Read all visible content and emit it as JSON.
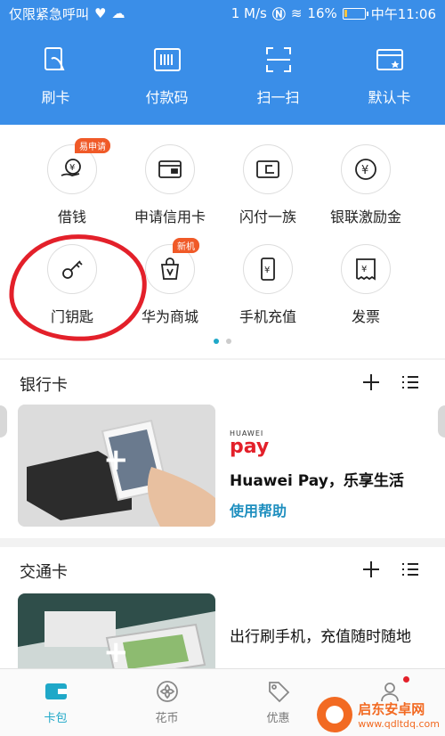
{
  "status": {
    "carrier": "仅限紧急呼叫",
    "speed": "1 M/s",
    "battery": "16%",
    "time": "中午11:06",
    "battery_level": 0.16
  },
  "quick": [
    {
      "label": "刷卡",
      "icon": "nfc-card-icon"
    },
    {
      "label": "付款码",
      "icon": "barcode-icon"
    },
    {
      "label": "扫一扫",
      "icon": "scan-icon"
    },
    {
      "label": "默认卡",
      "icon": "default-card-icon"
    }
  ],
  "services": [
    {
      "label": "借钱",
      "icon": "loan-icon",
      "badge": "易申请"
    },
    {
      "label": "申请信用卡",
      "icon": "credit-card-icon",
      "badge": ""
    },
    {
      "label": "闪付一族",
      "icon": "quickpass-icon",
      "badge": ""
    },
    {
      "label": "银联激励金",
      "icon": "yuan-coin-icon",
      "badge": ""
    },
    {
      "label": "门钥匙",
      "icon": "key-icon",
      "badge": ""
    },
    {
      "label": "华为商城",
      "icon": "shopping-bag-icon",
      "badge": "新机"
    },
    {
      "label": "手机充值",
      "icon": "phone-recharge-icon",
      "badge": ""
    },
    {
      "label": "发票",
      "icon": "invoice-icon",
      "badge": ""
    }
  ],
  "bank_section": {
    "title": "银行卡",
    "promo_logo_small": "HUAWEI",
    "promo_logo": "pay",
    "promo_title": "Huawei Pay，乐享生活",
    "promo_link": "使用帮助"
  },
  "transit_section": {
    "title": "交通卡",
    "promo_title": "出行刷手机，充值随时随地"
  },
  "nav": [
    {
      "label": "卡包",
      "icon": "wallet-icon",
      "active": true
    },
    {
      "label": "花币",
      "icon": "coin-icon",
      "active": false
    },
    {
      "label": "优惠",
      "icon": "tag-icon",
      "active": false
    },
    {
      "label": "",
      "icon": "profile-icon",
      "active": false
    }
  ],
  "watermark": {
    "title": "启东安卓网",
    "url": "www.qdltdq.com"
  },
  "colors": {
    "header_blue": "#3a8ee8",
    "accent_teal": "#1fa8c8",
    "annotation_red": "#e3202a",
    "badge_orange": "#f05a28"
  }
}
